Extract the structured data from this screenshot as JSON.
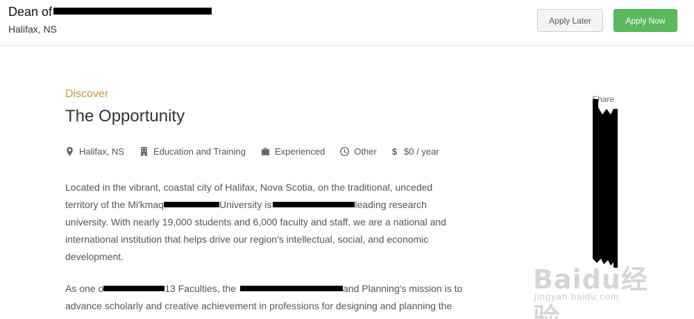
{
  "header": {
    "title_prefix": "Dean of",
    "location": "Halifax, NS",
    "apply_later_label": "Apply Later",
    "apply_now_label": "Apply Now"
  },
  "section": {
    "eyebrow": "Discover",
    "heading": "The Opportunity"
  },
  "meta": {
    "location": "Halifax, NS",
    "category": "Education and Training",
    "level": "Experienced",
    "type": "Other",
    "salary": "$0 / year",
    "icons": [
      "map-pin-icon",
      "building-icon",
      "briefcase-icon",
      "clock-icon",
      "dollar-icon"
    ]
  },
  "body": {
    "p1_line1": "Located in the vibrant, coastal city of Halifax, Nova Scotia, on the traditional, unceded",
    "p1_line2a": "territory of the Mi'kmaq",
    "p1_line2b": "University is",
    "p1_line2c": "leading research",
    "p1_line3": "university. With nearly 19,000 students and 6,000 faculty and staff, we are a national and",
    "p1_line4": "international institution that helps drive our region's intellectual, social, and economic",
    "p1_line5": "development.",
    "p2_line1a": "As one o",
    "p2_line1b": "13 Faculties, the",
    "p2_line1c": "and Planning's mission is to",
    "p2_line2": "advance scholarly and creative achievement in professions for designing and planning the"
  },
  "share": {
    "label": "Share"
  },
  "watermark": {
    "main": "Baidu经验",
    "sub": "jingyan.baidu.com"
  },
  "colors": {
    "accent": "#d4973a",
    "apply_now_bg": "#5cb85c",
    "apply_later_bg": "#f4f4f4"
  }
}
